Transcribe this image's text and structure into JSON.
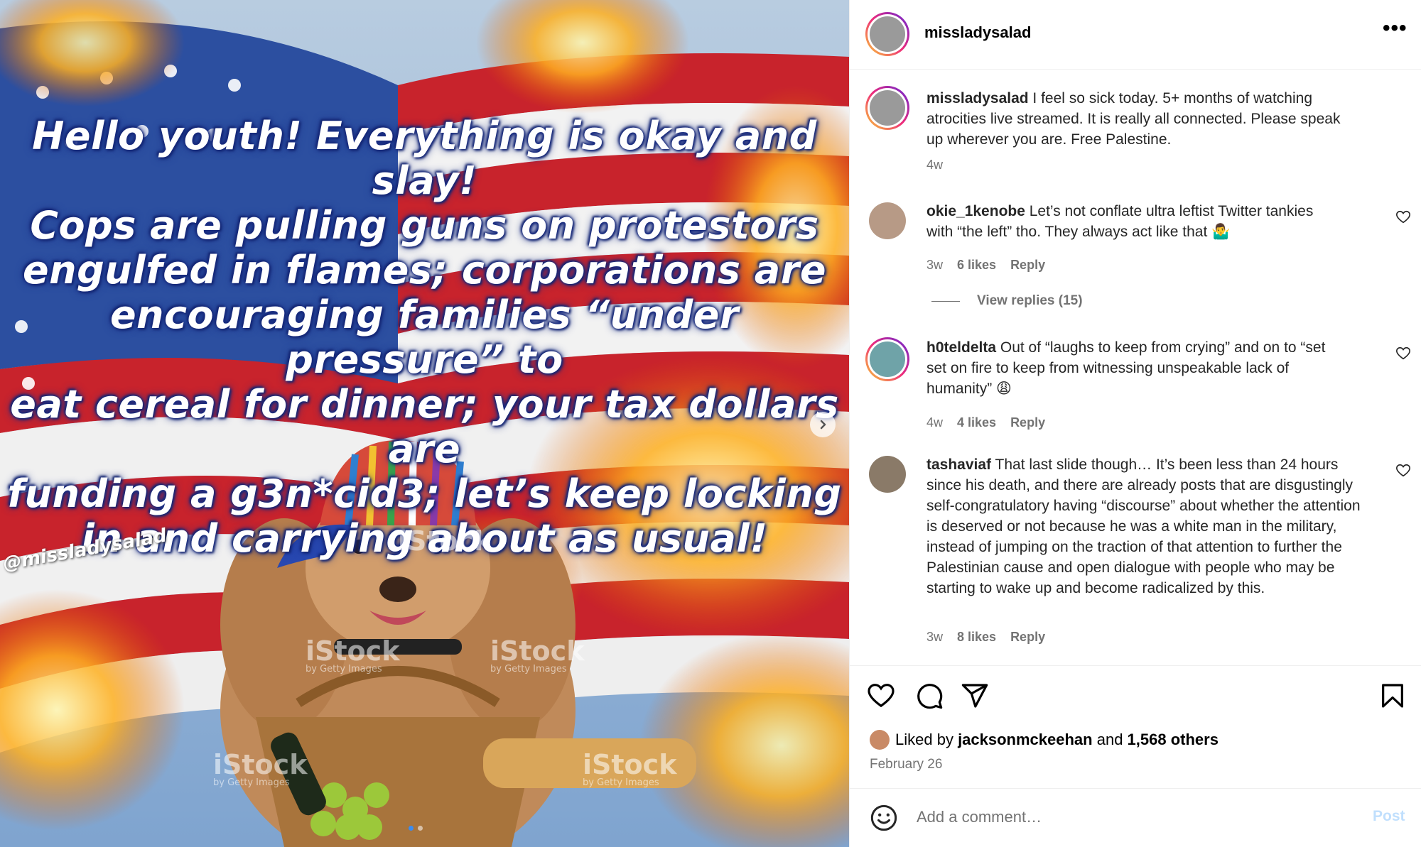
{
  "media": {
    "caption": "Hello youth! Everything is okay and slay!\nCops are pulling guns on protestors\nengulfed in flames; corporations are\nencouraging families “under pressure” to\neat cereal for dinner; your tax dollars are\nfunding a g3n*cid3; let’s keep locking\nin and carrying about as usual!",
    "handle_watermark": "@missladysalad",
    "stock_watermark": "iStock",
    "stock_sub": "by Getty Images",
    "next_icon": "chevron-right-icon",
    "slides": 2,
    "active_slide": 1
  },
  "header": {
    "username": "missladysalad",
    "more_icon": "more-horizontal-icon",
    "more_label": "•••"
  },
  "caption": {
    "username": "missladysalad",
    "text": " I feel so sick today. 5+ months of watching atrocities live streamed. It is really all connected. Please speak up wherever you are. Free Palestine.",
    "time": "4w"
  },
  "comments": [
    {
      "username": "okie_1kenobe",
      "text": " Let’s not conflate ultra leftist Twitter tankies with “the left” tho. They always act like that 🤷‍♂️",
      "time": "3w",
      "likes": "6 likes",
      "reply": "Reply"
    },
    {
      "username": "h0teldelta",
      "text": " Out of “laughs to keep from crying” and on to “set set on fire to keep from witnessing unspeakable lack of humanity” 😩",
      "time": "4w",
      "likes": "4 likes",
      "reply": "Reply"
    },
    {
      "username": "tashaviaf",
      "text": " That last slide though… It’s been less than 24 hours since his death, and there are already posts that are disgustingly self-congratulatory having “discourse” about whether the attention is deserved or not because he was a white man in the military, instead of jumping on the traction of that attention to further the Palestinian cause and open dialogue with people who may be starting to wake up and become radicalized by this.",
      "time": "3w",
      "likes": "8 likes",
      "reply": "Reply"
    }
  ],
  "view_replies": "View replies (15)",
  "actions": {
    "like_icon": "heart-icon",
    "comment_icon": "comment-icon",
    "share_icon": "send-icon",
    "save_icon": "bookmark-icon"
  },
  "likes": {
    "prefix": "Liked by ",
    "user": "jacksonmckeehan",
    "mid": " and ",
    "others": "1,568 others"
  },
  "date": "February 26",
  "add_comment": {
    "emoji_icon": "emoji-smile-icon",
    "placeholder": "Add a comment…",
    "post_label": "Post"
  },
  "colors": {
    "ring_gradient": [
      "#f9ce34",
      "#ee2a7b",
      "#6228d7"
    ],
    "muted_text": "#737373",
    "post_button_disabled": "#c0dffd",
    "caption_outline": "#1b2f86"
  }
}
